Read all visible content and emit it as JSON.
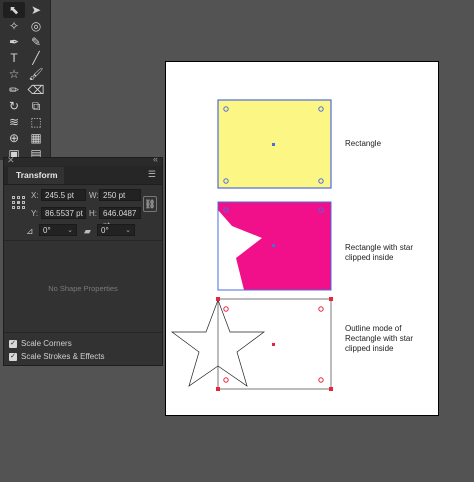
{
  "toolbar": {
    "tools": [
      {
        "name": "selection-tool-icon",
        "glyph": "⬉",
        "selected": true
      },
      {
        "name": "direct-selection-tool-icon",
        "glyph": "➤"
      },
      {
        "name": "magic-wand-tool-icon",
        "glyph": "✧"
      },
      {
        "name": "lasso-tool-icon",
        "glyph": "◎"
      },
      {
        "name": "pen-tool-icon",
        "glyph": "✒"
      },
      {
        "name": "curvature-tool-icon",
        "glyph": "✎"
      },
      {
        "name": "type-tool-icon",
        "glyph": "T"
      },
      {
        "name": "line-tool-icon",
        "glyph": "╱"
      },
      {
        "name": "star-tool-icon",
        "glyph": "☆"
      },
      {
        "name": "paintbrush-tool-icon",
        "glyph": "🖌"
      },
      {
        "name": "pencil-tool-icon",
        "glyph": "✏"
      },
      {
        "name": "eraser-tool-icon",
        "glyph": "⌫"
      },
      {
        "name": "rotate-tool-icon",
        "glyph": "↻"
      },
      {
        "name": "scale-tool-icon",
        "glyph": "⧉"
      },
      {
        "name": "warp-tool-icon",
        "glyph": "≋"
      },
      {
        "name": "free-transform-tool-icon",
        "glyph": "⬚"
      },
      {
        "name": "shape-builder-tool-icon",
        "glyph": "⊕"
      },
      {
        "name": "perspective-grid-tool-icon",
        "glyph": "▦"
      },
      {
        "name": "mesh-tool-icon",
        "glyph": "▣"
      },
      {
        "name": "gradient-tool-icon",
        "glyph": "▤"
      }
    ]
  },
  "transform_panel": {
    "tab_label": "Transform",
    "x_label": "X:",
    "x_value": "245.5 pt",
    "y_label": "Y:",
    "y_value": "86.5537 pt",
    "w_label": "W:",
    "w_value": "250 pt",
    "h_label": "H:",
    "h_value": "646.0487 pt",
    "rotate_value": "0°",
    "shear_value": "0°",
    "no_shape_text": "No Shape Properties",
    "scale_corners_label": "Scale Corners",
    "scale_strokes_label": "Scale Strokes & Effects"
  },
  "canvas": {
    "label_rectangle": "Rectangle",
    "label_clipped_1": "Rectangle with star",
    "label_clipped_2": "clipped inside",
    "label_outline_1": "Outline mode of",
    "label_outline_2": "Rectangle with star",
    "label_outline_3": "clipped inside",
    "colors": {
      "yellow_fill": "#fcf784",
      "magenta_fill": "#f20f8a",
      "selection_blue": "#4b6bdf",
      "selection_red": "#e8243c"
    }
  }
}
